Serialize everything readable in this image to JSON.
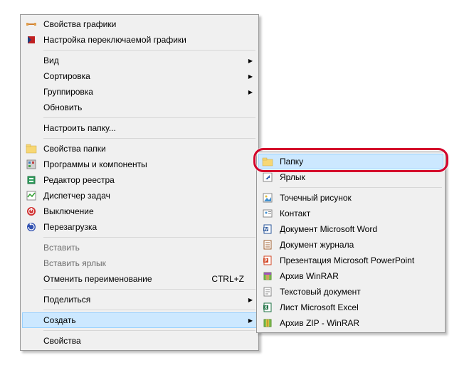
{
  "main_menu": {
    "graphics_props": "Свойства графики",
    "switchable_graphics": "Настройка переключаемой графики",
    "view": "Вид",
    "sort": "Сортировка",
    "group": "Группировка",
    "refresh": "Обновить",
    "customize_folder": "Настроить папку...",
    "folder_props": "Свойства папки",
    "programs_components": "Программы и компоненты",
    "registry_editor": "Редактор реестра",
    "task_manager": "Диспетчер задач",
    "shutdown": "Выключение",
    "restart": "Перезагрузка",
    "paste": "Вставить",
    "paste_shortcut": "Вставить ярлык",
    "undo_rename": "Отменить переименование",
    "undo_shortcut": "CTRL+Z",
    "share": "Поделиться",
    "create": "Создать",
    "properties": "Свойства"
  },
  "sub_menu": {
    "folder": "Папку",
    "shortcut": "Ярлык",
    "bitmap": "Точечный рисунок",
    "contact": "Контакт",
    "word_doc": "Документ Microsoft Word",
    "journal": "Документ журнала",
    "powerpoint": "Презентация Microsoft PowerPoint",
    "winrar": "Архив WinRAR",
    "text_doc": "Текстовый документ",
    "excel": "Лист Microsoft Excel",
    "zip_winrar": "Архив ZIP - WinRAR"
  }
}
